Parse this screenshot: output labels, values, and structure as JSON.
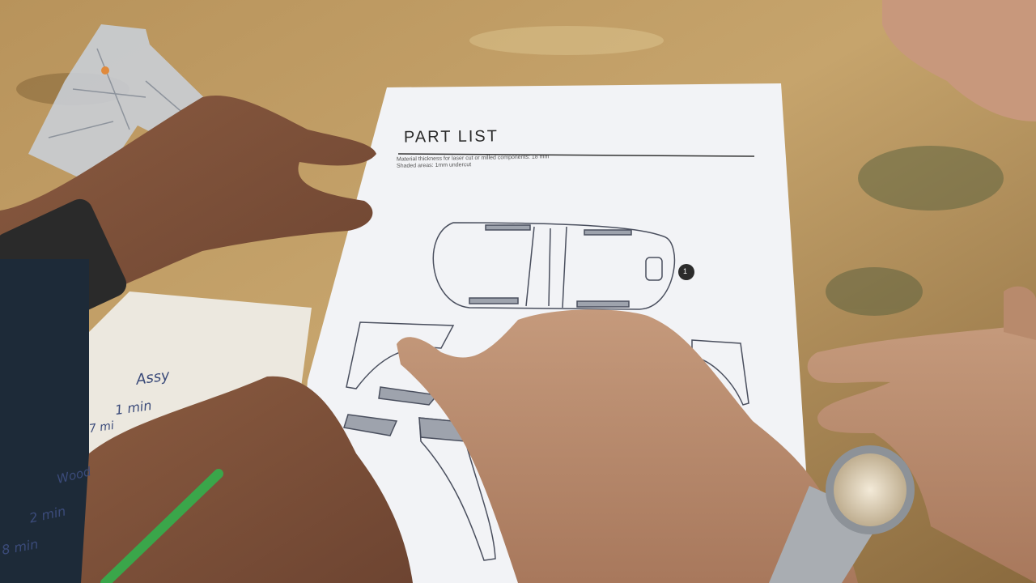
{
  "document": {
    "title": "PART LIST",
    "subtitle_line1": "Material thickness for laser cut or milled components: 18 mm",
    "subtitle_line2": "Shaded areas: 1mm undercut",
    "part_number": "1"
  },
  "notes": {
    "line1": "Assy",
    "line2": "1 min",
    "line3": "7 mi",
    "line4": "Wood",
    "line5": "2 min",
    "line6": "8 min"
  },
  "colors": {
    "table_wood": "#a07a45",
    "paper": "#f2f3f6",
    "skin": "#b5876a",
    "floorplan": "#c9ced6",
    "floorplan_marker": "#e08a3c",
    "pencil": "#3aa64a"
  }
}
